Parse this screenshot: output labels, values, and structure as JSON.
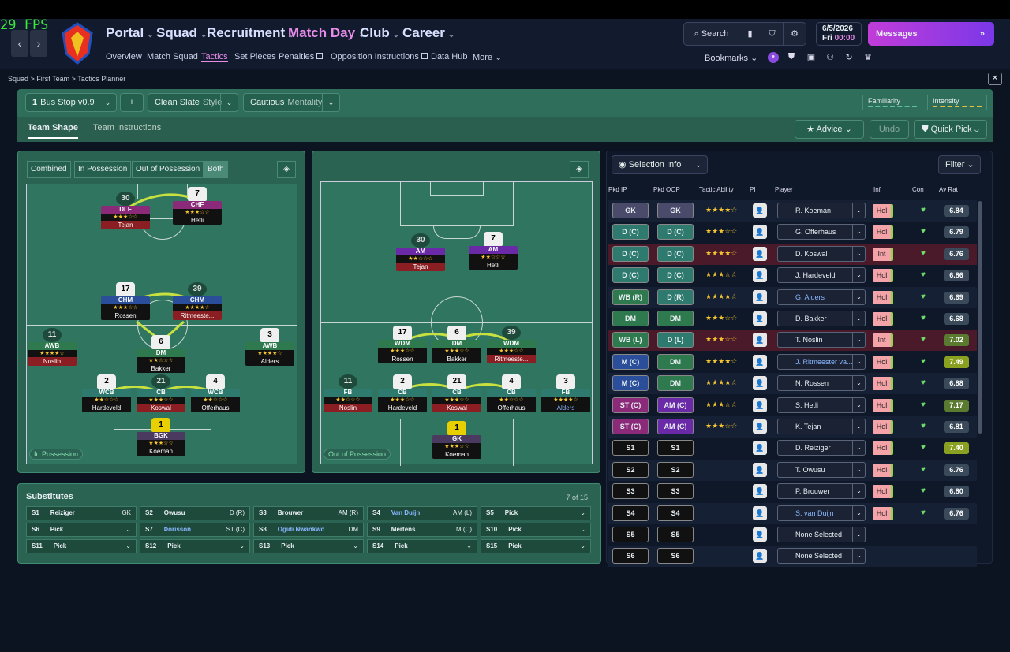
{
  "fps": "29 FPS",
  "nav": {
    "main": [
      "Portal",
      "Squad",
      "Recruitment",
      "Match Day",
      "Club",
      "Career"
    ],
    "sub": [
      "Overview",
      "Match Squad",
      "Tactics",
      "Set Pieces",
      "Penalties",
      "Opposition Instructions",
      "Data Hub",
      "More"
    ]
  },
  "header": {
    "search": "Search",
    "date": "6/5/2026",
    "day": "Fri",
    "time": "00:00",
    "messages": "Messages",
    "bookmarks": "Bookmarks"
  },
  "breadcrumb": "Squad  >  First Team  >  Tactics Planner",
  "tactic": {
    "name": "Bus Stop v0.9",
    "style": "Clean Slate",
    "style_label": "Style",
    "mentality": "Cautious",
    "mentality_label": "Mentality",
    "familiarity": "Familiarity",
    "intensity": "Intensity"
  },
  "tabs": {
    "team_shape": "Team Shape",
    "team_instructions": "Team Instructions",
    "advice": "Advice",
    "undo": "Undo",
    "quick_pick": "Quick Pick"
  },
  "phase": {
    "combined": "Combined",
    "in_possession": "In Possession",
    "out_of_possession": "Out of Possession",
    "both": "Both"
  },
  "pitch_in": {
    "label": "In Possession",
    "players": [
      {
        "num": "30",
        "pos": "DLF",
        "name": "Tejan",
        "stars": "★★★☆☆"
      },
      {
        "num": "7",
        "pos": "CHF",
        "name": "Hetli",
        "stars": "★★★☆☆"
      },
      {
        "num": "17",
        "pos": "CHM",
        "name": "Rossen",
        "stars": "★★★☆☆"
      },
      {
        "num": "39",
        "pos": "CHM",
        "name": "Ritmeeste...",
        "stars": "★★★★☆"
      },
      {
        "num": "11",
        "pos": "AWB",
        "name": "Noslin",
        "stars": "★★★★☆"
      },
      {
        "num": "6",
        "pos": "DM",
        "name": "Bakker",
        "stars": "★★☆☆☆"
      },
      {
        "num": "3",
        "pos": "AWB",
        "name": "Alders",
        "stars": "★★★★☆"
      },
      {
        "num": "2",
        "pos": "WCB",
        "name": "Hardeveld",
        "stars": "★★☆☆☆"
      },
      {
        "num": "21",
        "pos": "CB",
        "name": "Koswal",
        "stars": "★★★☆☆"
      },
      {
        "num": "4",
        "pos": "WCB",
        "name": "Offerhaus",
        "stars": "★★☆☆☆"
      },
      {
        "num": "1",
        "pos": "BGK",
        "name": "Koeman",
        "stars": "★★★☆☆"
      }
    ]
  },
  "pitch_out": {
    "label": "Out of Possession",
    "players": [
      {
        "num": "30",
        "pos": "AM",
        "name": "Tejan",
        "stars": "★★☆☆☆"
      },
      {
        "num": "7",
        "pos": "AM",
        "name": "Hetli",
        "stars": "★★☆☆☆"
      },
      {
        "num": "17",
        "pos": "WDM",
        "name": "Rossen",
        "stars": "★★★☆☆"
      },
      {
        "num": "6",
        "pos": "DM",
        "name": "Bakker",
        "stars": "★★★☆☆"
      },
      {
        "num": "39",
        "pos": "WDM",
        "name": "Ritmeeste...",
        "stars": "★★★☆☆"
      },
      {
        "num": "11",
        "pos": "FB",
        "name": "Noslin",
        "stars": "★★☆☆☆"
      },
      {
        "num": "2",
        "pos": "CB",
        "name": "Hardeveld",
        "stars": "★★★☆☆"
      },
      {
        "num": "21",
        "pos": "CB",
        "name": "Koswal",
        "stars": "★★★☆☆"
      },
      {
        "num": "4",
        "pos": "CB",
        "name": "Offerhaus",
        "stars": "★★☆☆☆"
      },
      {
        "num": "3",
        "pos": "FB",
        "name": "Alders",
        "stars": "★★★★☆"
      },
      {
        "num": "1",
        "pos": "GK",
        "name": "Koeman",
        "stars": "★★★☆☆"
      }
    ]
  },
  "subs": {
    "title": "Substitutes",
    "count": "7 of 15",
    "slots": [
      {
        "s": "S1",
        "name": "Reiziger",
        "pos": "GK"
      },
      {
        "s": "S2",
        "name": "Owusu",
        "pos": "D (R)"
      },
      {
        "s": "S3",
        "name": "Brouwer",
        "pos": "AM (R)"
      },
      {
        "s": "S4",
        "name": "Van Duijn",
        "pos": "AM (L)"
      },
      {
        "s": "S5",
        "name": "Pick",
        "pos": ""
      },
      {
        "s": "S6",
        "name": "Pick",
        "pos": ""
      },
      {
        "s": "S7",
        "name": "Þórisson",
        "pos": "ST (C)"
      },
      {
        "s": "S8",
        "name": "Ogidi Nwankwo",
        "pos": "DM"
      },
      {
        "s": "S9",
        "name": "Mertens",
        "pos": "M (C)"
      },
      {
        "s": "S10",
        "name": "Pick",
        "pos": ""
      },
      {
        "s": "S11",
        "name": "Pick",
        "pos": ""
      },
      {
        "s": "S12",
        "name": "Pick",
        "pos": ""
      },
      {
        "s": "S13",
        "name": "Pick",
        "pos": ""
      },
      {
        "s": "S14",
        "name": "Pick",
        "pos": ""
      },
      {
        "s": "S15",
        "name": "Pick",
        "pos": ""
      }
    ]
  },
  "selection": {
    "info": "Selection Info",
    "filter": "Filter",
    "headers": [
      "Pkd IP",
      "Pkd OOP",
      "Tactic Ability",
      "PI",
      "Player",
      "Inf",
      "Con",
      "Av Rat"
    ],
    "rows": [
      {
        "ip": "GK",
        "oop": "GK",
        "stars": "★★★★☆",
        "player": "R. Koeman",
        "inf": "Hol",
        "rat": "6.84"
      },
      {
        "ip": "D (C)",
        "oop": "D (C)",
        "stars": "★★★☆☆",
        "player": "G. Offerhaus",
        "inf": "Hol",
        "rat": "6.79"
      },
      {
        "ip": "D (C)",
        "oop": "D (C)",
        "stars": "★★★★☆",
        "player": "D. Koswal",
        "inf": "Int",
        "rat": "6.76"
      },
      {
        "ip": "D (C)",
        "oop": "D (C)",
        "stars": "★★★☆☆",
        "player": "J. Hardeveld",
        "inf": "Hol",
        "rat": "6.86"
      },
      {
        "ip": "WB (R)",
        "oop": "D (R)",
        "stars": "★★★★☆",
        "player": "G. Alders",
        "inf": "Hol",
        "rat": "6.69"
      },
      {
        "ip": "DM",
        "oop": "DM",
        "stars": "★★★☆☆",
        "player": "D. Bakker",
        "inf": "Hol",
        "rat": "6.68"
      },
      {
        "ip": "WB (L)",
        "oop": "D (L)",
        "stars": "★★★☆☆",
        "player": "T. Noslin",
        "inf": "Int",
        "rat": "7.02"
      },
      {
        "ip": "M (C)",
        "oop": "DM",
        "stars": "★★★★☆",
        "player": "J. Ritmeester va...",
        "inf": "Hol",
        "rat": "7.49"
      },
      {
        "ip": "M (C)",
        "oop": "DM",
        "stars": "★★★★☆",
        "player": "N. Rossen",
        "inf": "Hol",
        "rat": "6.88"
      },
      {
        "ip": "ST (C)",
        "oop": "AM (C)",
        "stars": "★★★☆☆",
        "player": "S. Hetli",
        "inf": "Hol",
        "rat": "7.17"
      },
      {
        "ip": "ST (C)",
        "oop": "AM (C)",
        "stars": "★★★☆☆",
        "player": "K. Tejan",
        "inf": "Hol",
        "rat": "6.81"
      },
      {
        "ip": "S1",
        "oop": "S1",
        "stars": "",
        "player": "D. Reiziger",
        "inf": "Hol",
        "rat": "7.40"
      },
      {
        "ip": "S2",
        "oop": "S2",
        "stars": "",
        "player": "T. Owusu",
        "inf": "Hol",
        "rat": "6.76"
      },
      {
        "ip": "S3",
        "oop": "S3",
        "stars": "",
        "player": "P. Brouwer",
        "inf": "Hol",
        "rat": "6.80"
      },
      {
        "ip": "S4",
        "oop": "S4",
        "stars": "",
        "player": "S. van Duijn",
        "inf": "Hol",
        "rat": "6.76"
      },
      {
        "ip": "S5",
        "oop": "S5",
        "stars": "",
        "player": "None Selected",
        "inf": "",
        "rat": ""
      },
      {
        "ip": "S6",
        "oop": "S6",
        "stars": "",
        "player": "None Selected",
        "inf": "",
        "rat": ""
      }
    ]
  }
}
